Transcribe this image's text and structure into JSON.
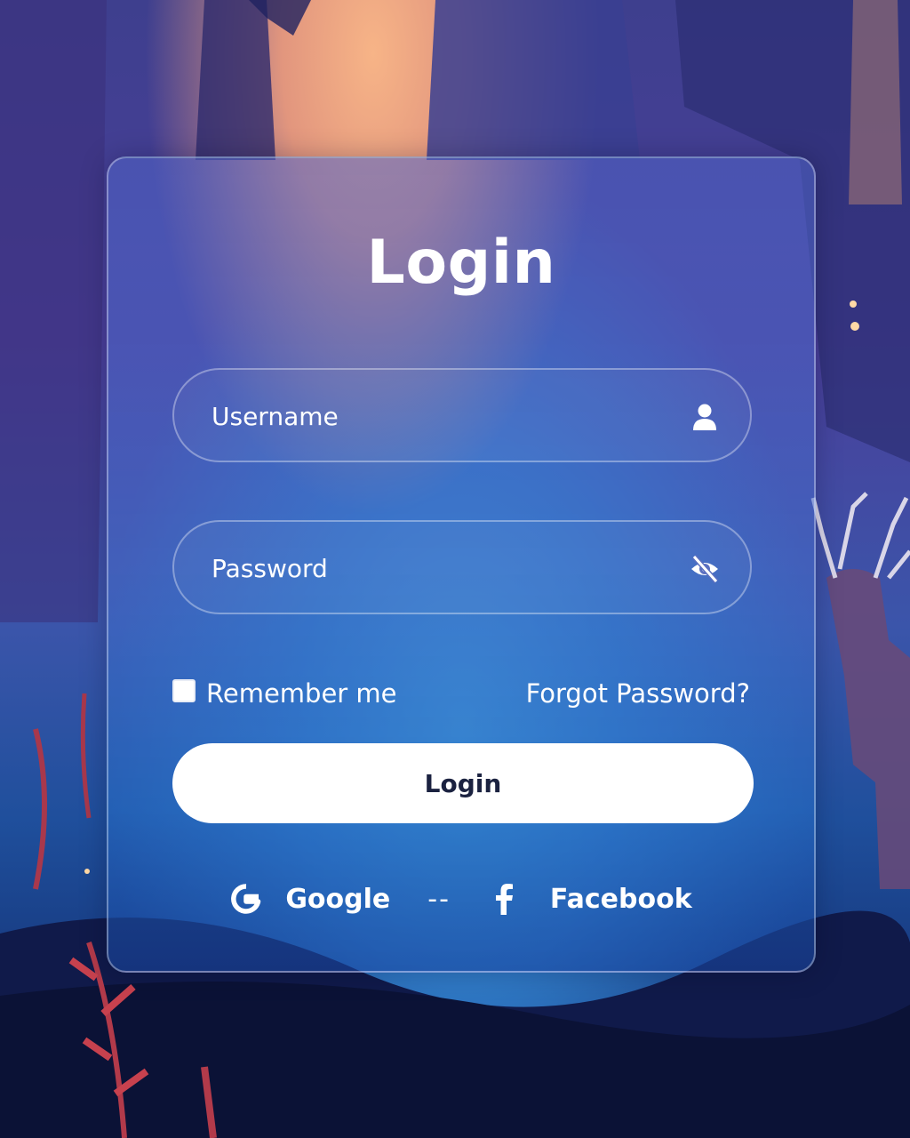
{
  "login": {
    "title": "Login",
    "username_placeholder": "Username",
    "password_placeholder": "Password",
    "remember_label": "Remember me",
    "forgot_label": "Forgot Password?",
    "submit_label": "Login",
    "social": {
      "google_label": "Google",
      "separator": "--",
      "facebook_label": "Facebook"
    }
  },
  "icons": {
    "username": "user-icon",
    "password": "eye-slash-icon",
    "google": "google-icon",
    "facebook": "facebook-icon"
  },
  "colors": {
    "card_text": "#ffffff",
    "button_bg": "#ffffff",
    "button_text": "#1b2240",
    "sky_glow": "#f7b487",
    "forest_blue": "#2f78c4"
  }
}
